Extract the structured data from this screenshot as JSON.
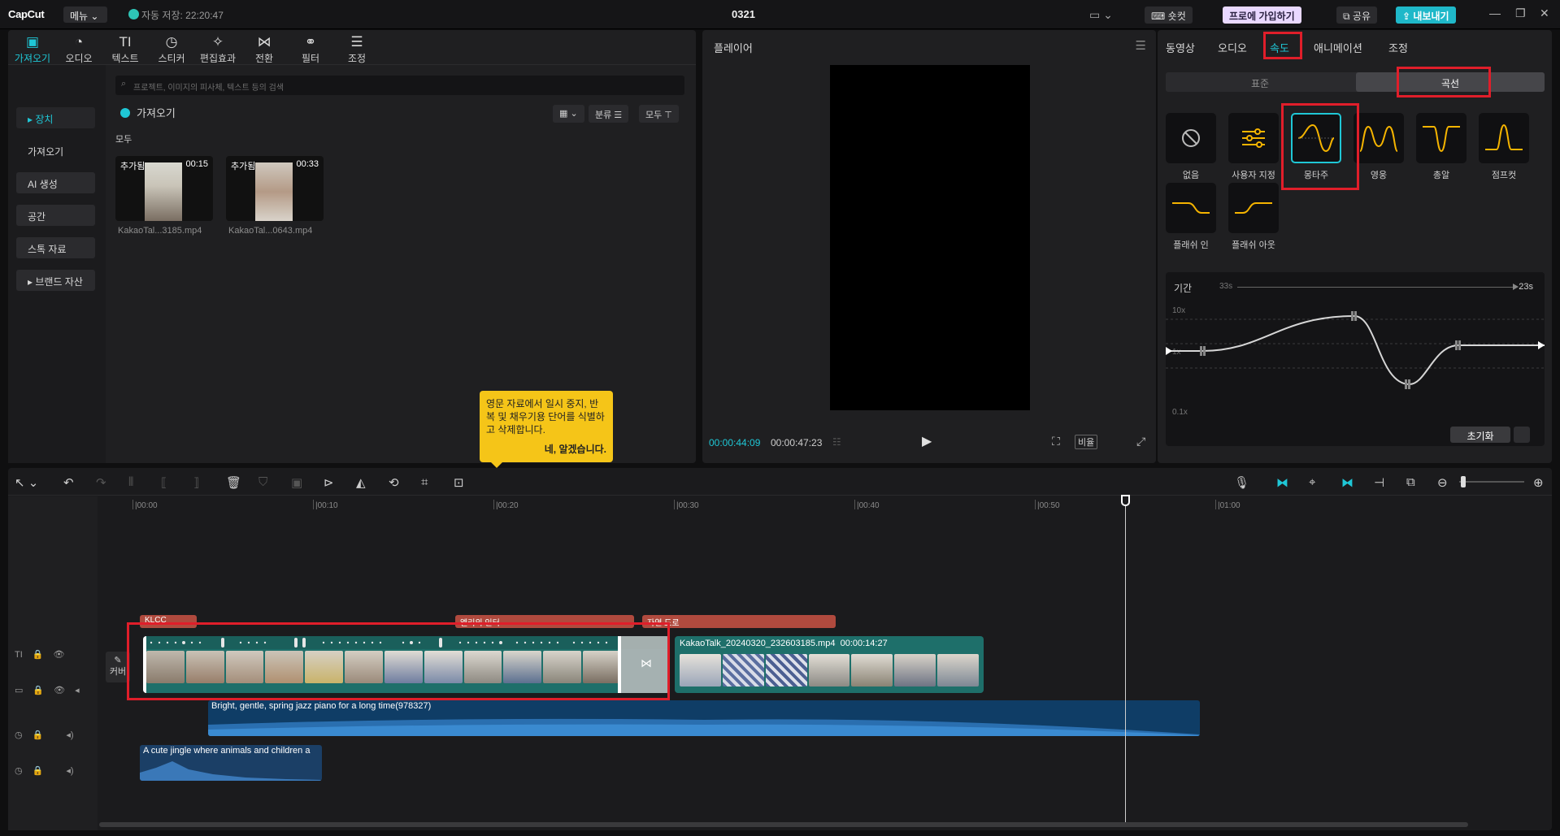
{
  "app": {
    "logo": "CapCut",
    "menu_label": "메뉴 ⌄",
    "autosave": "자동 저장: 22:20:47",
    "project_name": "0321",
    "shortcut_label": "숏컷",
    "pro_label": "프로에 가입하기",
    "share_label": "공유",
    "export_label": "내보내기"
  },
  "media_tabs": [
    {
      "label": "가져오기",
      "icon": "import-icon",
      "glyph": "▣"
    },
    {
      "label": "오디오",
      "icon": "audio-icon",
      "glyph": "◔"
    },
    {
      "label": "텍스트",
      "icon": "text-icon",
      "glyph": "TI"
    },
    {
      "label": "스티커",
      "icon": "sticker-icon",
      "glyph": "◷"
    },
    {
      "label": "편집효과",
      "icon": "effects-icon",
      "glyph": "✧"
    },
    {
      "label": "전환",
      "icon": "transition-icon",
      "glyph": "⋈"
    },
    {
      "label": "필터",
      "icon": "filter-icon",
      "glyph": "⚭"
    },
    {
      "label": "조정",
      "icon": "adjust-icon",
      "glyph": "☰"
    }
  ],
  "side_nav": [
    "▸ 장치",
    "가져오기",
    "AI 생성",
    "공간",
    "스톡 자료",
    "▸ 브랜드 자산"
  ],
  "search_placeholder": "프로젝트, 이미지의 피사체, 텍스트 등의 검색",
  "import_label": "가져오기",
  "filters": {
    "sort": "분류 ☰",
    "all": "모두 ⊤"
  },
  "all_label": "모두",
  "media_items": [
    {
      "tag": "추가됨",
      "duration": "00:15",
      "name": "KakaoTal...3185.mp4"
    },
    {
      "tag": "추가됨",
      "duration": "00:33",
      "name": "KakaoTal...0643.mp4"
    }
  ],
  "tooltip": {
    "text": "영문 자료에서 일시 중지, 반복 및 채우기용 단어를 식별하고 삭제합니다.",
    "ok": "네, 알겠습니다."
  },
  "player": {
    "title": "플레이어",
    "time_current": "00:00:44:09",
    "time_total": "00:00:47:23",
    "ratio_label": "비율"
  },
  "props": {
    "tabs": [
      "동영상",
      "오디오",
      "속도",
      "애니메이션",
      "조정"
    ],
    "active_tab": "속도",
    "speed_modes": [
      "표준",
      "곡선"
    ],
    "active_mode": "곡선",
    "presets": [
      "없음",
      "사용자 지정",
      "몽타주",
      "영웅",
      "총알",
      "점프컷",
      "플래쉬 인",
      "플래쉬 아웃"
    ],
    "selected_preset": "몽타주",
    "duration_label": "기간",
    "duration_from": "33s",
    "duration_to": "23s",
    "y_max": "10x",
    "y_min": "0.1x",
    "y_mid": "1x",
    "reset_label": "초기화"
  },
  "timeline": {
    "ticks": [
      "|00:00",
      "|00:10",
      "|00:20",
      "|00:30",
      "|00:40",
      "|00:50",
      "|01:00"
    ],
    "cover_label": "커버",
    "text_clips": [
      "KLCC",
      "엘리의 인터",
      "자연 도로"
    ],
    "clip_name": "KakaoTalk_20240320_232603185.mp4",
    "clip_duration": "00:00:14:27",
    "audio_1": "Bright, gentle, spring jazz piano for a long time(978327)",
    "audio_2": "A cute jingle where animals and children a"
  },
  "colors": {
    "accent": "#1fc7d6",
    "highlight_box": "#e01e2a",
    "curve_preset_line": "#f5b400",
    "video_clip": "#1e6f6a",
    "audio_clip": "#0f3d66",
    "text_clip": "#b04a3e"
  }
}
